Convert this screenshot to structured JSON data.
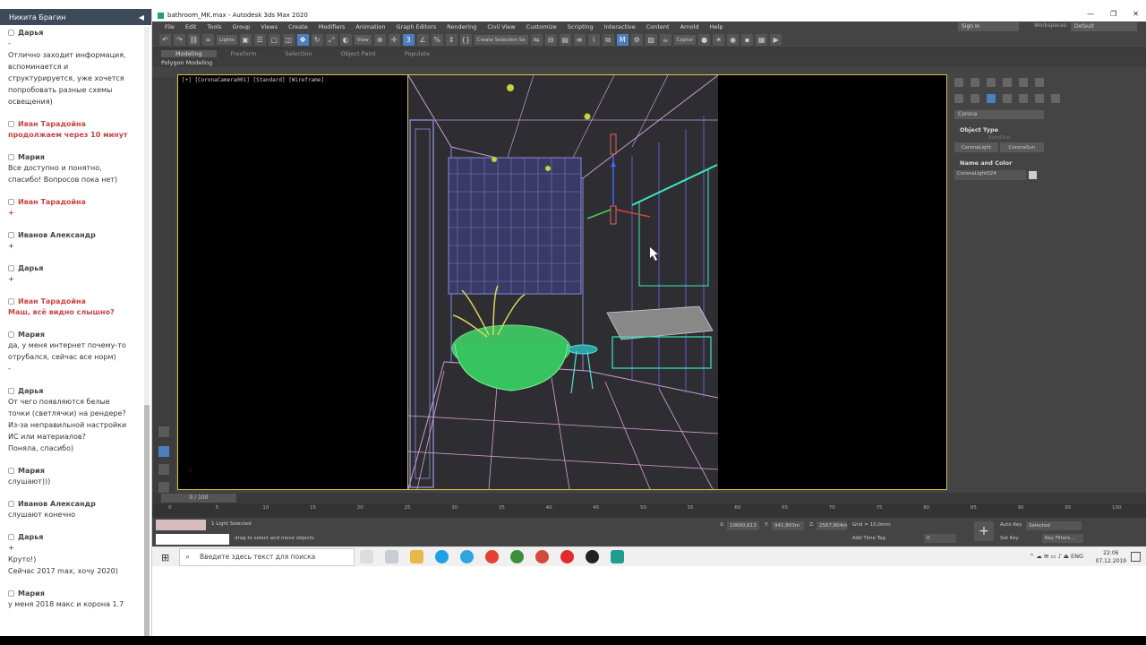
{
  "chat": {
    "header_name": "Никита Брагин",
    "collapse_icon": "◀",
    "messages": [
      {
        "name": "Дарья",
        "lines": [
          "-",
          "Отлично заходит информация,",
          "вспоминается и",
          "структурируется, уже хочется",
          "попробовать разные схемы",
          "освещения)"
        ],
        "highlight": false
      },
      {
        "name": "Иван Тарадойна",
        "lines": [
          "продолжаем через 10 минут"
        ],
        "highlight": true
      },
      {
        "name": "Мария",
        "lines": [
          "Все доступно и понятно,",
          "спасибо! Вопросов пока нет)"
        ],
        "highlight": false
      },
      {
        "name": "Иван Тарадойна",
        "lines": [
          "+"
        ],
        "highlight": true
      },
      {
        "name": "Иванов Александр",
        "lines": [
          "+"
        ],
        "highlight": false
      },
      {
        "name": "Дарья",
        "lines": [
          "+"
        ],
        "highlight": false
      },
      {
        "name": "Иван Тарадойна",
        "lines": [
          "Маш, всё видно слышно?"
        ],
        "highlight": true
      },
      {
        "name": "Мария",
        "lines": [
          "да, у меня интернет почему-то",
          "отрубался, сейчас все норм)",
          "-"
        ],
        "highlight": false
      },
      {
        "name": "Дарья",
        "lines": [
          "От чего появляются белые",
          "точки (светлячки) на рендере?",
          "Из-за неправильной настройки",
          "ИС или материалов?",
          "Поняла, спасибо)"
        ],
        "highlight": false
      },
      {
        "name": "Мария",
        "lines": [
          "слушают)))"
        ],
        "highlight": false
      },
      {
        "name": "Иванов Александр",
        "lines": [
          "слушают конечно"
        ],
        "highlight": false
      },
      {
        "name": "Дарья",
        "lines": [
          "+",
          "Круто!)",
          "Сейчас 2017 max, хочу 2020)"
        ],
        "highlight": false
      },
      {
        "name": "Мария",
        "lines": [
          "у меня 2018 макс и корона 1.7"
        ],
        "highlight": false
      }
    ]
  },
  "max": {
    "title": "bathroom_MK.max - Autodesk 3ds Max 2020",
    "window_buttons": [
      "—",
      "❐",
      "✕"
    ],
    "menus": [
      "File",
      "Edit",
      "Tools",
      "Group",
      "Views",
      "Create",
      "Modifiers",
      "Animation",
      "Graph Editors",
      "Rendering",
      "Civil View",
      "Customize",
      "Scripting",
      "Interactive",
      "Content",
      "Arnold",
      "Help"
    ],
    "sign_in": "Sign In",
    "workspaces_label": "Workspaces:",
    "workspaces_value": "Default",
    "toolbar": {
      "lights_drop": "Lights",
      "view_drop": "View",
      "selection_set": "Create Selection Se",
      "coptor": "Coptor"
    },
    "ribbon_tabs": [
      "Modeling",
      "Freeform",
      "Selection",
      "Object Paint",
      "Populate"
    ],
    "subribbon": "Polygon Modeling",
    "viewport_label": "[+] [CoronaCamera001] [Standard] [Wireframe]",
    "command_panel": {
      "renderer": "Corona",
      "object_type_title": "Object Type",
      "autogrid": "AutoGrid",
      "buttons": [
        "CoronaLight",
        "CoronaSun"
      ],
      "name_color_title": "Name and Color",
      "name_value": "CoronaLight024"
    },
    "time_slider": "0 / 100",
    "track_ticks": [
      "0",
      "5",
      "10",
      "15",
      "20",
      "25",
      "30",
      "35",
      "40",
      "45",
      "50",
      "55",
      "60",
      "65",
      "70",
      "75",
      "80",
      "85",
      "90",
      "95",
      "100"
    ],
    "status": {
      "selected_text": "1 Light Selected",
      "prompt_text": "drag to select and move objects",
      "x_label": "X:",
      "x_value": "10660,613",
      "y_label": "Y:",
      "y_value": "941,803m",
      "z_label": "Z:",
      "z_value": "2567,804m",
      "grid": "Grid = 10,0mm",
      "add_time_tag": "Add Time Tag",
      "auto_key": "Auto Key",
      "set_key": "Set Key",
      "selected_drop": "Selected",
      "key_filters": "Key Filters...",
      "frame_value": "0"
    }
  },
  "taskbar": {
    "search_placeholder": "Введите здесь текст для поиска",
    "lang": "ENG",
    "time": "22:06",
    "date": "07.12.2019"
  }
}
